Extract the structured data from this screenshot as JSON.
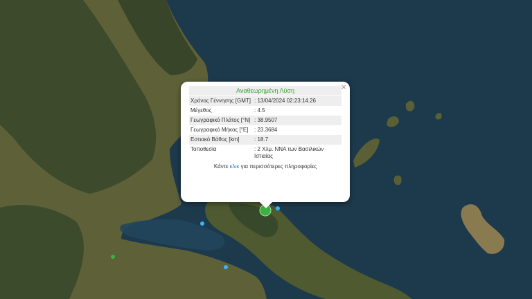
{
  "popup": {
    "title": "Αναθεωρημένη Λύση",
    "close": "×",
    "rows": [
      {
        "label": "Χρόνος Γέννησης [GMT]",
        "value": ": 13/04/2024 02:23:14.26"
      },
      {
        "label": "Μέγεθος",
        "value": ": 4.5"
      },
      {
        "label": "Γεωγραφικό Πλάτος [°N]",
        "value": ": 38.9507"
      },
      {
        "label": "Γεωγραφικό Μήκος [°E]",
        "value": ": 23.3684"
      },
      {
        "label": "Εστιακό Βάθος [km]",
        "value": ": 18.7"
      },
      {
        "label": "Τοποθεσία",
        "value": ": 2 Χλμ. ΝΝΑ των Βασιλικών Ιστιαίας"
      }
    ],
    "more_prefix": "Κάντε ",
    "more_link": "κλικ",
    "more_suffix": " για περισσότερες πληροφορίες"
  },
  "colors": {
    "sea": "#1d3a4d",
    "land": "#5e6138",
    "forest": "#37472a",
    "epicenter": "#3cb043",
    "recent_quake": "#35b6ff"
  }
}
